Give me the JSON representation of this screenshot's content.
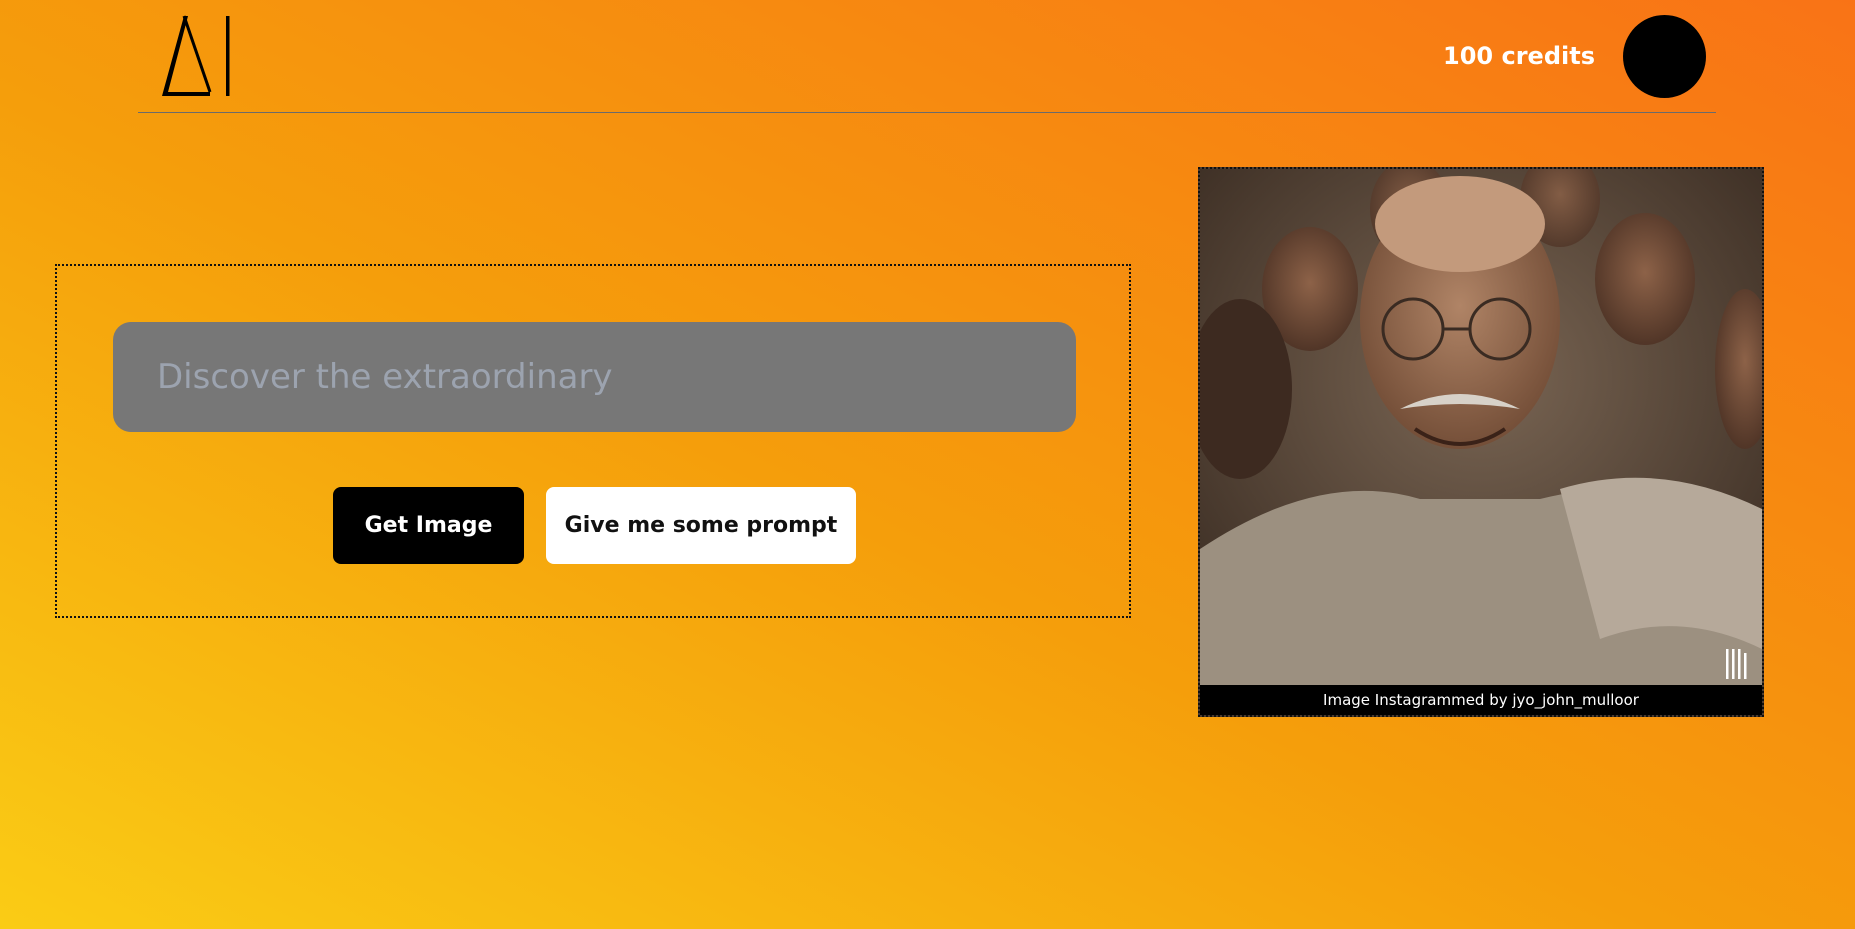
{
  "header": {
    "logo_text": "AI",
    "credits_label": "100 credits"
  },
  "form": {
    "prompt_placeholder": "Discover the extraordinary",
    "get_image_label": "Get Image",
    "give_prompt_label": "Give me some prompt"
  },
  "image_card": {
    "caption": "Image Instagrammed by jyo_john_mulloor",
    "photo_icon": "elderly-man-selfie-crowd-image"
  },
  "colors": {
    "accent_dark": "#000000",
    "input_bg": "#777777",
    "gradient_start": "#facc15",
    "gradient_end": "#f97316"
  }
}
